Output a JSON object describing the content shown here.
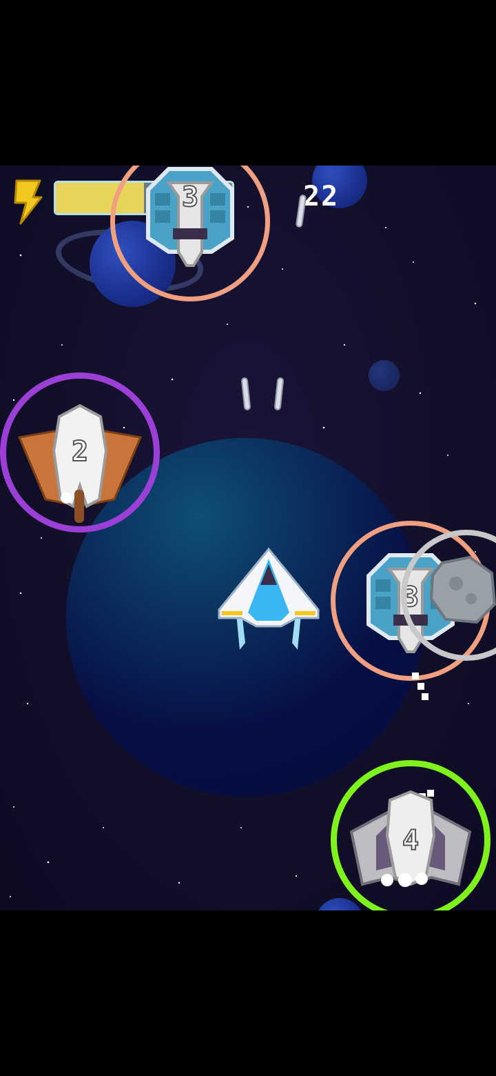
{
  "hud": {
    "energy_icon": "lightning-bolt-icon",
    "energy_level": 0.5,
    "score": "22"
  },
  "enemies": [
    {
      "id": "enemy-teal-top",
      "label": "3",
      "ring_color": "#f0a080"
    },
    {
      "id": "enemy-orange-left",
      "label": "2",
      "ring_color": "#9b3fd6"
    },
    {
      "id": "enemy-teal-right",
      "label": "3",
      "ring_color": "#f0a080"
    },
    {
      "id": "enemy-gray-bottom",
      "label": "4",
      "ring_color": "#7ff21e"
    }
  ],
  "asteroid": {
    "ring_color": "#c8c8c8"
  },
  "colors": {
    "space": "#120f2a",
    "energy_fill": "#e8d45a",
    "player_accent": "#3ab7f2"
  }
}
